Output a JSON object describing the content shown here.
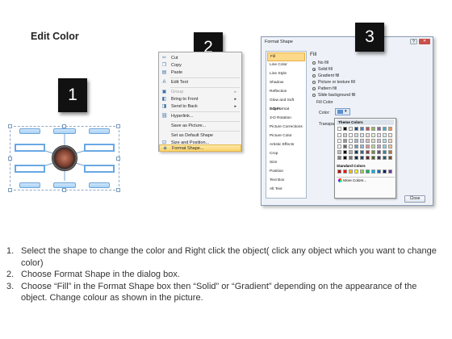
{
  "title": "Edit Color",
  "steps": [
    "1",
    "2",
    "3"
  ],
  "context_menu": {
    "items": [
      {
        "label": "Cut",
        "icon": "scissors-icon",
        "glyph": "✂",
        "disabled": false
      },
      {
        "label": "Copy",
        "icon": "copy-icon",
        "glyph": "❐",
        "disabled": false
      },
      {
        "label": "Paste",
        "icon": "paste-icon",
        "glyph": "▤",
        "disabled": false
      },
      {
        "label": "Edit Text",
        "icon": "edit-text-icon",
        "glyph": "A",
        "disabled": false
      },
      {
        "label": "Group",
        "icon": "group-icon",
        "glyph": "▣",
        "disabled": true,
        "submenu": true
      },
      {
        "label": "Bring to Front",
        "icon": "bring-front-icon",
        "glyph": "◧",
        "disabled": false,
        "submenu": true
      },
      {
        "label": "Send to Back",
        "icon": "send-back-icon",
        "glyph": "◨",
        "disabled": false,
        "submenu": true
      },
      {
        "label": "Hyperlink...",
        "icon": "hyperlink-icon",
        "glyph": "⛓",
        "disabled": false
      },
      {
        "label": "Save as Picture...",
        "icon": "",
        "glyph": "",
        "disabled": false
      },
      {
        "label": "Set as Default Shape",
        "icon": "",
        "glyph": "",
        "disabled": false
      },
      {
        "label": "Size and Position...",
        "icon": "size-icon",
        "glyph": "⊡",
        "disabled": false
      },
      {
        "label": "Format Shape...",
        "icon": "format-shape-icon",
        "glyph": "◈",
        "disabled": false,
        "highlighted": true
      }
    ]
  },
  "dialog": {
    "title": "Format Shape",
    "window_buttons": [
      "?",
      "✕"
    ],
    "categories": [
      "Fill",
      "Line Color",
      "Line Style",
      "Shadow",
      "Reflection",
      "Glow and Soft Edges",
      "3-D Format",
      "3-D Rotation",
      "Picture Corrections",
      "Picture Color",
      "Artistic Effects",
      "Crop",
      "Size",
      "Position",
      "Text Box",
      "Alt Text"
    ],
    "selected_category": "Fill",
    "fill_heading": "Fill",
    "fill_options": [
      {
        "label": "No fill",
        "selected": false
      },
      {
        "label": "Solid fill",
        "selected": true
      },
      {
        "label": "Gradient fill",
        "selected": false
      },
      {
        "label": "Picture or texture fill",
        "selected": false
      },
      {
        "label": "Pattern fill",
        "selected": false
      },
      {
        "label": "Slide background fill",
        "selected": false
      }
    ],
    "fill_color_label": "Fill Color",
    "color_label": "Color:",
    "transparency_label": "Transpa",
    "close_label": "Close"
  },
  "palette": {
    "theme_colors_label": "Theme Colors",
    "standard_colors_label": "Standard Colors",
    "more_colors_label": "More Colors...",
    "theme_top_row": [
      "#ffffff",
      "#000000",
      "#eeece1",
      "#1f497d",
      "#4f81bd",
      "#c0504d",
      "#9bbb59",
      "#8064a2",
      "#4bacc6",
      "#f79646"
    ],
    "standard_colors": [
      "#c00000",
      "#ff0000",
      "#ffc000",
      "#ffff00",
      "#92d050",
      "#00b050",
      "#00b0f0",
      "#0070c0",
      "#002060",
      "#7030a0"
    ]
  },
  "instructions": [
    {
      "num": "1.",
      "text": "Select the shape to change the color and Right click the object( click any object which you want to change color)"
    },
    {
      "num": "2.",
      "text": "Choose Format Shape in the dialog box."
    },
    {
      "num": "3.",
      "text": "Choose “Fill” in the Format Shape box then “Solid” or “Gradient” depending on the appearance of the object. Change colour as shown in the picture."
    }
  ]
}
